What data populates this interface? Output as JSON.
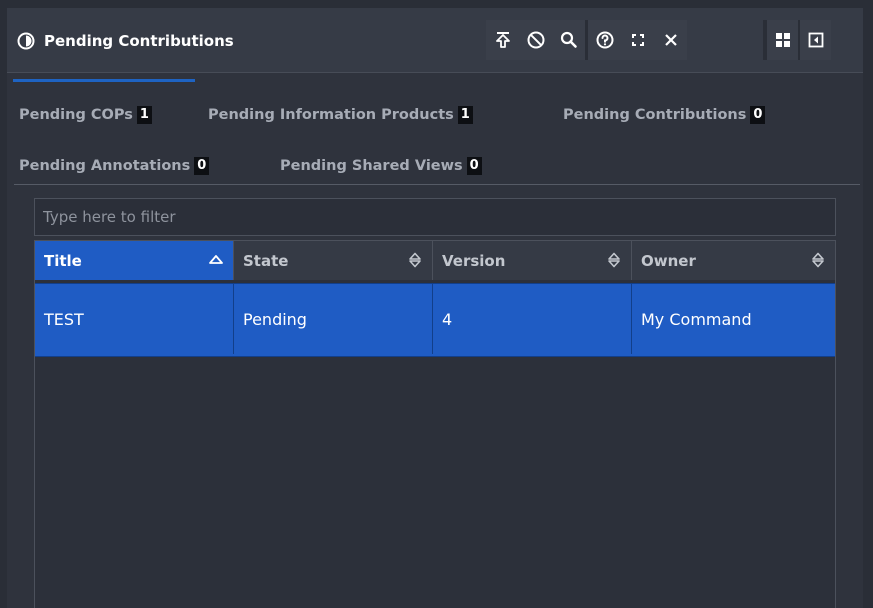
{
  "window": {
    "title": "Pending Contributions",
    "title_icon": "half-circle-icon",
    "toolbar": {
      "group1": [
        "push-to-top-icon",
        "cancel-icon",
        "search-icon"
      ],
      "group2": [
        "help-icon",
        "expand-icon",
        "close-icon"
      ],
      "group3": [
        "grid-layout-icon",
        "dock-left-icon"
      ]
    }
  },
  "filters": [
    {
      "label": "Pending COPs",
      "count": "1"
    },
    {
      "label": "Pending Information Products",
      "count": "1"
    },
    {
      "label": "Pending Contributions",
      "count": "0"
    },
    {
      "label": "Pending Annotations",
      "count": "0"
    },
    {
      "label": "Pending Shared Views",
      "count": "0"
    }
  ],
  "search": {
    "placeholder": "Type here to filter",
    "value": ""
  },
  "table": {
    "columns": [
      {
        "label": "Title",
        "sort": "ascending"
      },
      {
        "label": "State",
        "sort": "none"
      },
      {
        "label": "Version",
        "sort": "none"
      },
      {
        "label": "Owner",
        "sort": "none"
      }
    ],
    "rows": [
      {
        "title": "TEST",
        "state": "Pending",
        "version": "4",
        "owner": "My Command",
        "selected": true
      }
    ]
  },
  "colors": {
    "accent": "#1f5cc4",
    "panel_bg": "#2f333d",
    "titlebar_bg": "#363b46",
    "badge_bg": "#0d0f13"
  }
}
